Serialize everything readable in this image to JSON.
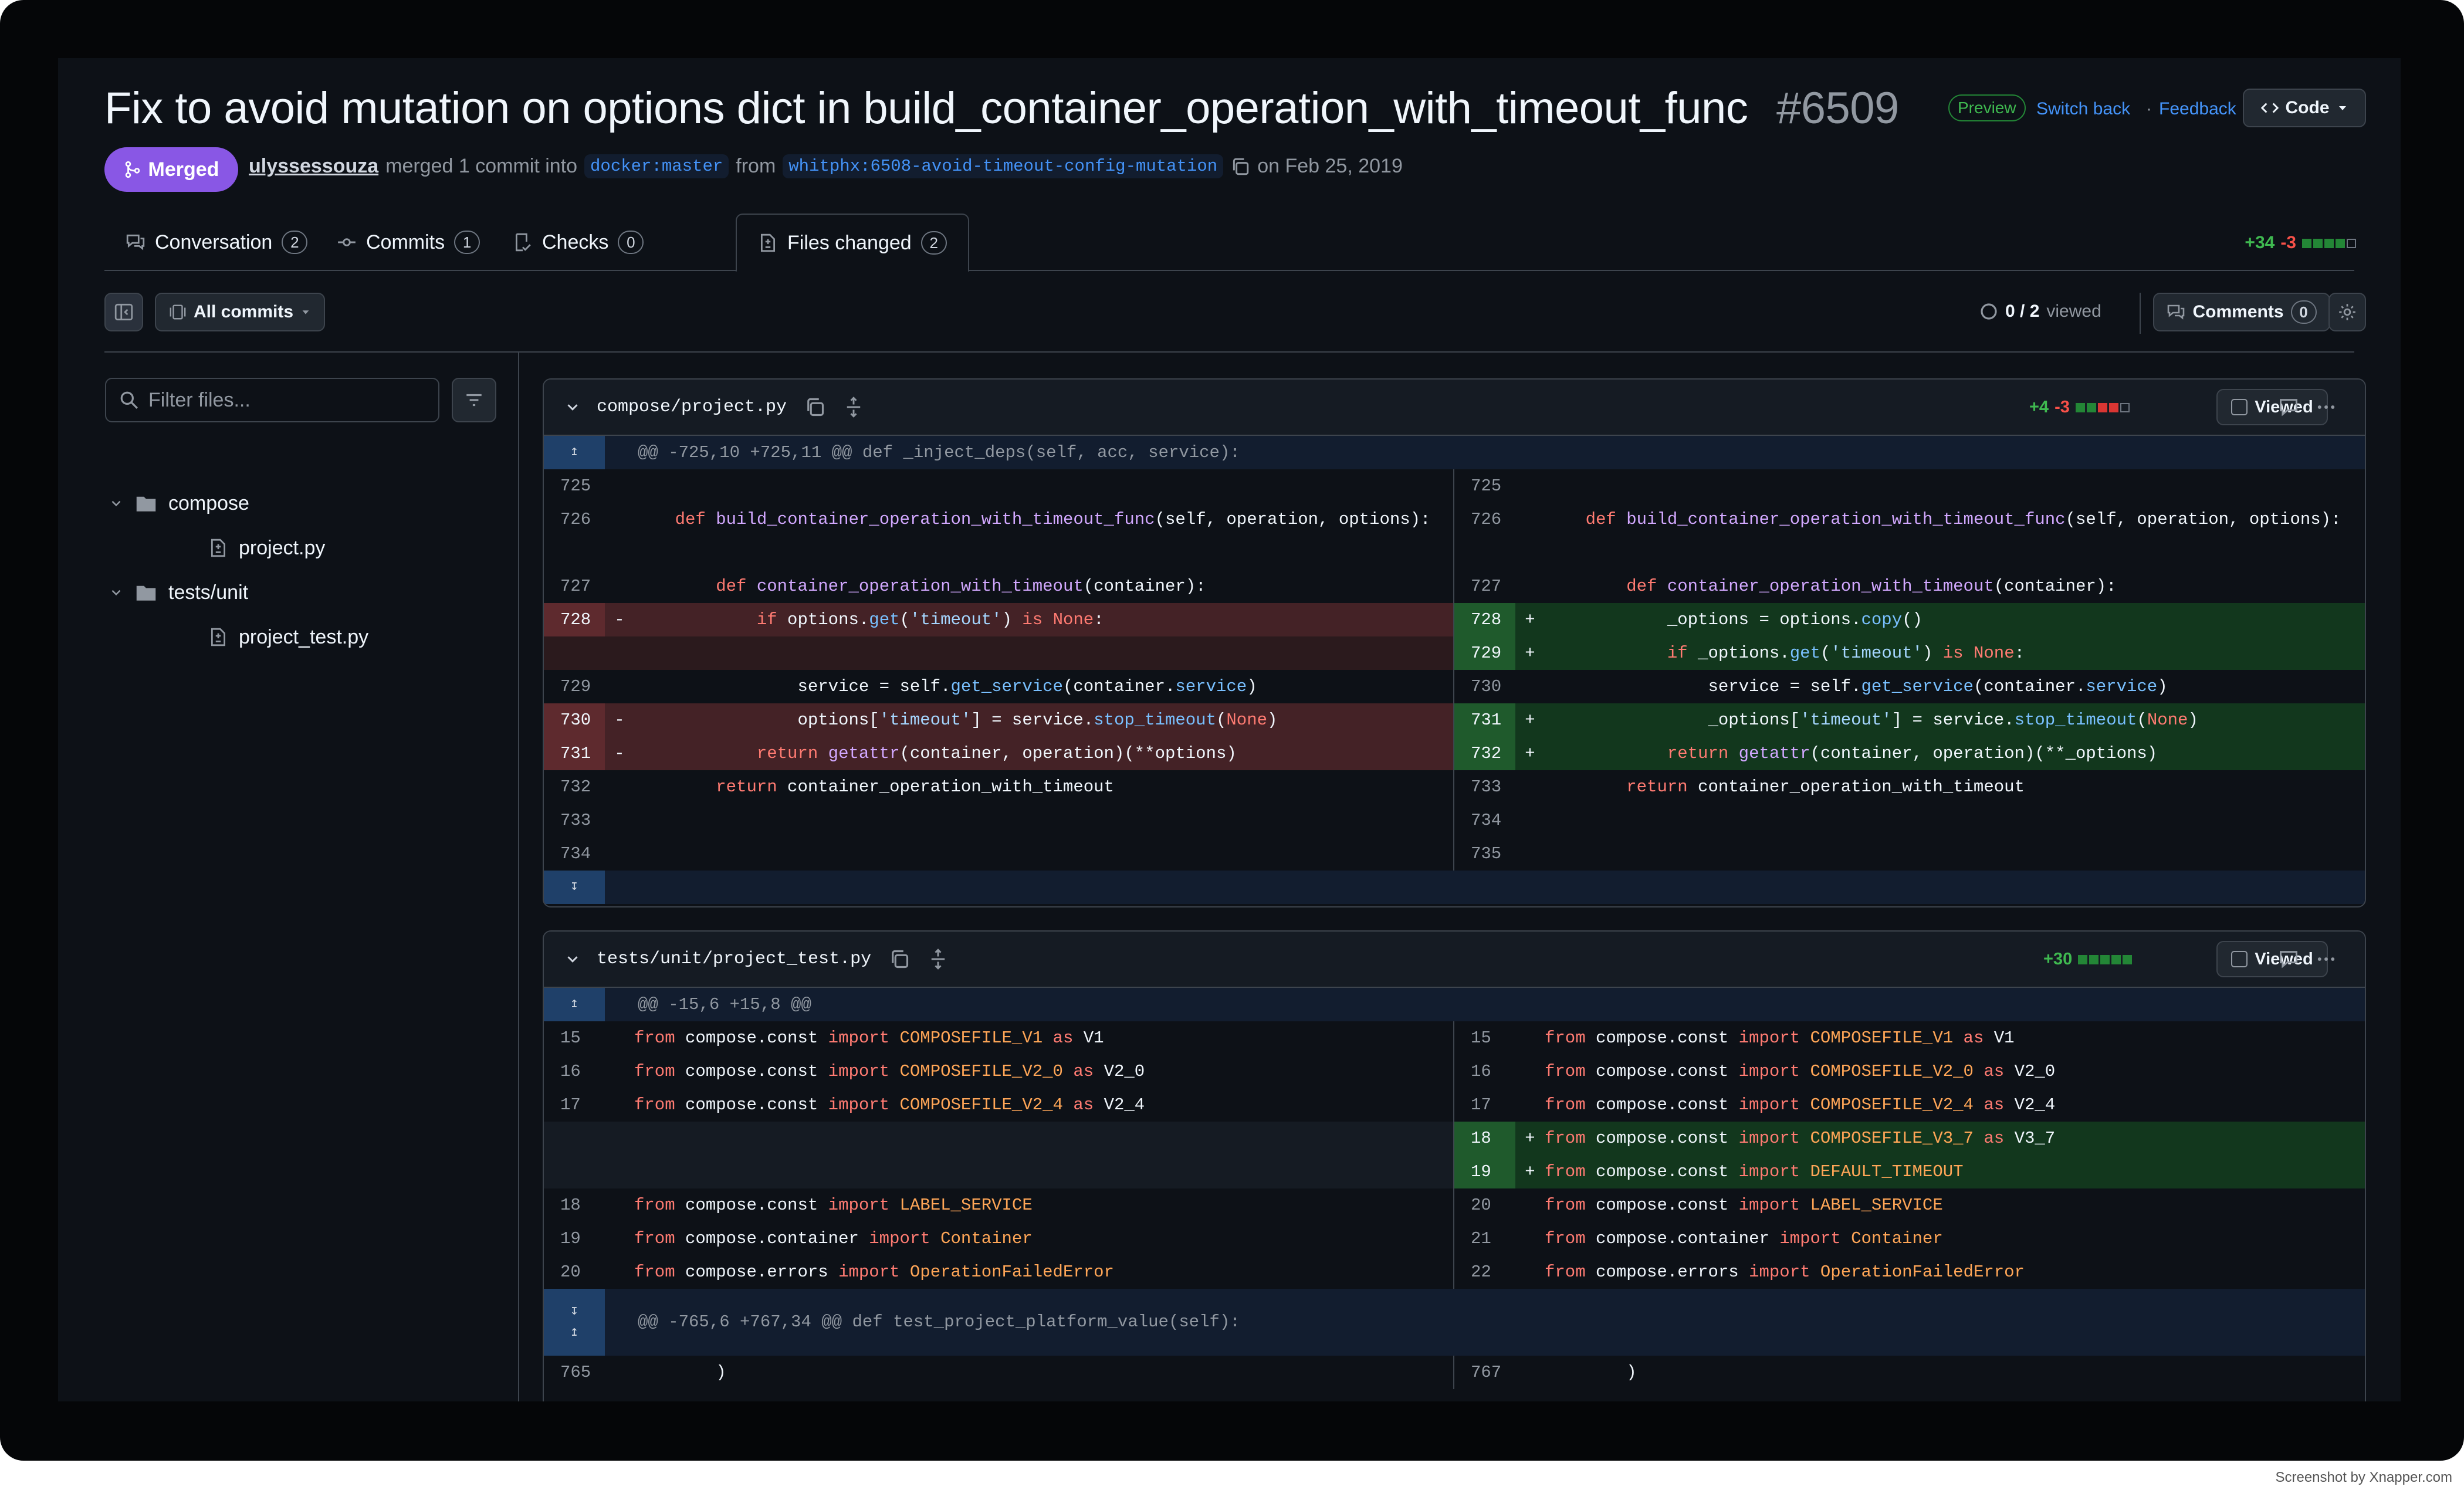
{
  "pr": {
    "title": "Fix to avoid mutation on options dict in build_container_operation_with_timeout_func",
    "number": "#6509",
    "status": "Merged",
    "author": "ulyssessouza",
    "merge_text": "merged 1 commit into",
    "base_branch": "docker:master",
    "from_text": "from",
    "head_branch": "whitphx:6508-avoid-timeout-config-mutation",
    "date": "on Feb 25, 2019"
  },
  "header": {
    "preview": "Preview",
    "switch_back": "Switch back",
    "sep": "·",
    "feedback": "Feedback",
    "code_btn": "Code"
  },
  "tabs": [
    {
      "label": "Conversation",
      "count": "2"
    },
    {
      "label": "Commits",
      "count": "1"
    },
    {
      "label": "Checks",
      "count": "0"
    },
    {
      "label": "Files changed",
      "count": "2"
    }
  ],
  "diffstat": {
    "add": "+34",
    "del": "-3"
  },
  "toolbar": {
    "all_commits": "All commits",
    "viewed_count": "0 / 2",
    "viewed_suffix": "viewed",
    "comments": "Comments",
    "comments_count": "0"
  },
  "sidebar": {
    "filter_placeholder": "Filter files...",
    "tree": [
      {
        "name": "compose",
        "type": "folder"
      },
      {
        "name": "project.py",
        "type": "file"
      },
      {
        "name": "tests/unit",
        "type": "folder"
      },
      {
        "name": "project_test.py",
        "type": "file"
      }
    ]
  },
  "files": [
    {
      "path": "compose/project.py",
      "add": "+4",
      "del": "-3",
      "viewed": "Viewed",
      "hunk": "@@ -725,10 +725,11 @@ def _inject_deps(self, acc, service):",
      "lines": [
        {
          "ln": "725",
          "rn": "725",
          "l": "",
          "r": ""
        },
        {
          "ln": "726",
          "rn": "726",
          "l": "    def build_container_operation_with_timeout_func(self, operation, options):",
          "r": "    def build_container_operation_with_timeout_func(self, operation, options):"
        },
        {
          "ln": "727",
          "rn": "727",
          "l": "        def container_operation_with_timeout(container):",
          "r": "        def container_operation_with_timeout(container):"
        },
        {
          "ln": "728",
          "rn": "728",
          "l": "            if options.get('timeout') is None:",
          "r": "            _options = options.copy()"
        },
        {
          "ln": "",
          "rn": "729",
          "l": "",
          "r": "            if _options.get('timeout') is None:"
        },
        {
          "ln": "729",
          "rn": "730",
          "l": "                service = self.get_service(container.service)",
          "r": "                service = self.get_service(container.service)"
        },
        {
          "ln": "730",
          "rn": "731",
          "l": "                options['timeout'] = service.stop_timeout(None)",
          "r": "                _options['timeout'] = service.stop_timeout(None)"
        },
        {
          "ln": "731",
          "rn": "732",
          "l": "            return getattr(container, operation)(**options)",
          "r": "            return getattr(container, operation)(**_options)"
        },
        {
          "ln": "732",
          "rn": "733",
          "l": "        return container_operation_with_timeout",
          "r": "        return container_operation_with_timeout"
        },
        {
          "ln": "733",
          "rn": "734",
          "l": "",
          "r": ""
        },
        {
          "ln": "734",
          "rn": "735",
          "l": "",
          "r": ""
        }
      ]
    },
    {
      "path": "tests/unit/project_test.py",
      "add": "+30",
      "viewed": "Viewed",
      "hunk": "@@ -15,6 +15,8 @@",
      "hunk2": "@@ -765,6 +767,34 @@ def test_project_platform_value(self):",
      "lines": [
        {
          "ln": "15",
          "rn": "15",
          "l": "from compose.const import COMPOSEFILE_V1 as V1",
          "r": "from compose.const import COMPOSEFILE_V1 as V1"
        },
        {
          "ln": "16",
          "rn": "16",
          "l": "from compose.const import COMPOSEFILE_V2_0 as V2_0",
          "r": "from compose.const import COMPOSEFILE_V2_0 as V2_0"
        },
        {
          "ln": "17",
          "rn": "17",
          "l": "from compose.const import COMPOSEFILE_V2_4 as V2_4",
          "r": "from compose.const import COMPOSEFILE_V2_4 as V2_4"
        },
        {
          "ln": "",
          "rn": "18",
          "l": "",
          "r": "from compose.const import COMPOSEFILE_V3_7 as V3_7"
        },
        {
          "ln": "",
          "rn": "19",
          "l": "",
          "r": "from compose.const import DEFAULT_TIMEOUT"
        },
        {
          "ln": "18",
          "rn": "20",
          "l": "from compose.const import LABEL_SERVICE",
          "r": "from compose.const import LABEL_SERVICE"
        },
        {
          "ln": "19",
          "rn": "21",
          "l": "from compose.container import Container",
          "r": "from compose.container import Container"
        },
        {
          "ln": "20",
          "rn": "22",
          "l": "from compose.errors import OperationFailedError",
          "r": "from compose.errors import OperationFailedError"
        },
        {
          "ln": "765",
          "rn": "767",
          "l": "        )",
          "r": "        )"
        }
      ]
    }
  ],
  "credit": "Screenshot by Xnapper.com",
  "colors": {
    "merged": "#8957e5",
    "add_bg": "#12371d",
    "del_bg": "#442226",
    "link": "#4493f8"
  }
}
